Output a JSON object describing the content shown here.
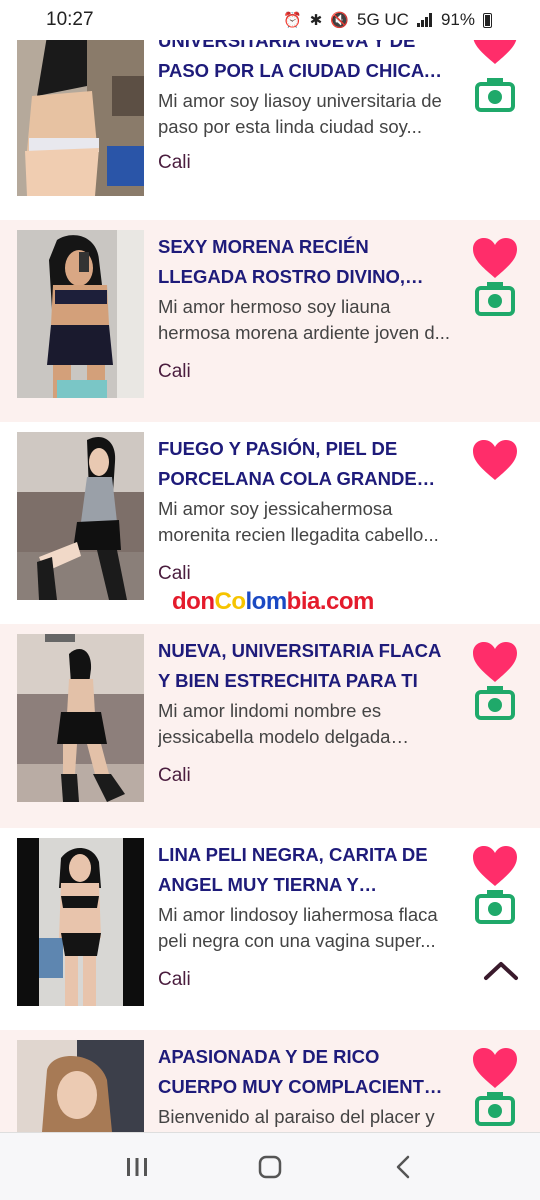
{
  "status": {
    "time": "10:27",
    "network": "5G UC",
    "battery": "91%",
    "icons": [
      "alarm-icon",
      "bluetooth-icon",
      "mute-icon",
      "signal-icon",
      "battery-icon"
    ]
  },
  "brand": {
    "part1": "don",
    "part2": "Co",
    "part3": "lom",
    "part4": "bia.com"
  },
  "listings": [
    {
      "title": "UNIVERSITARIA NUEVA Y DE PASO POR LA CIUDAD CHICA SQUIRTING",
      "description": "Mi amor soy liasoy universitaria de paso por esta linda ciudad soy...",
      "city": "Cali",
      "has_photos": true
    },
    {
      "title": "SEXY MORENA RECIÉN LLEGADA ROSTRO DIVINO, BIEN ESTRECHITA",
      "description": "Mi amor hermoso soy liauna hermosa morena ardiente joven d...",
      "city": "Cali",
      "has_photos": true
    },
    {
      "title": "FUEGO Y PASIÓN, PIEL DE PORCELANA COLA GRANDE TOD...",
      "description": "Mi amor soy jessicahermosa morenita recien llegadita cabello...",
      "city": "Cali",
      "has_photos": false
    },
    {
      "title": "NUEVA, UNIVERSITARIA FLACA Y BIEN ESTRECHITA PARA TI",
      "description": "Mi amor lindomi nombre es jessicabella modelo delgada joven...",
      "city": "Cali",
      "has_photos": true
    },
    {
      "title": "LINA PELI NEGRA, CARITA DE ANGEL MUY TIERNA Y DISPUEST...",
      "description": "Mi amor lindosoy liahermosa flaca peli negra con una vagina super...",
      "city": "Cali",
      "has_photos": true
    },
    {
      "title": "APASIONADA Y DE RICO CUERPO MUY COMPLACIENTE AMANTE D...",
      "description": "Bienvenido al paraiso del placer y la",
      "city": "",
      "has_photos": true
    }
  ],
  "colors": {
    "title": "#1e1b7a",
    "heart": "#ff2d6a",
    "camera": "#1fa96a",
    "card_tint": "#fcf1ef",
    "city": "#4a1d3e"
  },
  "nav": {
    "recent": "recent-apps-icon",
    "home": "home-icon",
    "back": "back-icon"
  }
}
